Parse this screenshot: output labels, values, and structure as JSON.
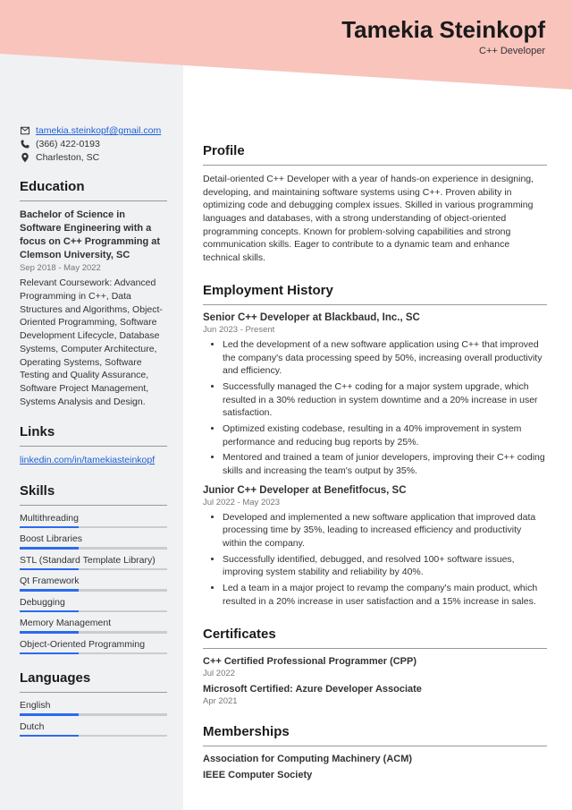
{
  "header": {
    "name": "Tamekia Steinkopf",
    "title": "C++ Developer"
  },
  "contact": {
    "email": "tamekia.steinkopf@gmail.com",
    "phone": "(366) 422-0193",
    "location": "Charleston, SC"
  },
  "education": {
    "heading": "Education",
    "degree": "Bachelor of Science in Software Engineering with a focus on C++ Programming at Clemson University, SC",
    "dates": "Sep 2018 - May 2022",
    "desc": "Relevant Coursework: Advanced Programming in C++, Data Structures and Algorithms, Object-Oriented Programming, Software Development Lifecycle, Database Systems, Computer Architecture, Operating Systems, Software Testing and Quality Assurance, Software Project Management, Systems Analysis and Design."
  },
  "links": {
    "heading": "Links",
    "url": "linkedin.com/in/tamekiasteinkopf"
  },
  "skills": {
    "heading": "Skills",
    "items": [
      {
        "name": "Multithreading",
        "level": 40
      },
      {
        "name": "Boost Libraries",
        "level": 40
      },
      {
        "name": "STL (Standard Template Library)",
        "level": 40
      },
      {
        "name": "Qt Framework",
        "level": 40
      },
      {
        "name": "Debugging",
        "level": 40
      },
      {
        "name": "Memory Management",
        "level": 40
      },
      {
        "name": "Object-Oriented Programming",
        "level": 40
      }
    ]
  },
  "languages": {
    "heading": "Languages",
    "items": [
      {
        "name": "English",
        "level": 40
      },
      {
        "name": "Dutch",
        "level": 40
      }
    ]
  },
  "profile": {
    "heading": "Profile",
    "text": "Detail-oriented C++ Developer with a year of hands-on experience in designing, developing, and maintaining software systems using C++. Proven ability in optimizing code and debugging complex issues. Skilled in various programming languages and databases, with a strong understanding of object-oriented programming concepts. Known for problem-solving capabilities and strong communication skills. Eager to contribute to a dynamic team and enhance technical skills."
  },
  "employment": {
    "heading": "Employment History",
    "jobs": [
      {
        "title": "Senior C++ Developer at Blackbaud, Inc., SC",
        "dates": "Jun 2023 - Present",
        "bullets": [
          "Led the development of a new software application using C++ that improved the company's data processing speed by 50%, increasing overall productivity and efficiency.",
          "Successfully managed the C++ coding for a major system upgrade, which resulted in a 30% reduction in system downtime and a 20% increase in user satisfaction.",
          "Optimized existing codebase, resulting in a 40% improvement in system performance and reducing bug reports by 25%.",
          "Mentored and trained a team of junior developers, improving their C++ coding skills and increasing the team's output by 35%."
        ]
      },
      {
        "title": "Junior C++ Developer at Benefitfocus, SC",
        "dates": "Jul 2022 - May 2023",
        "bullets": [
          "Developed and implemented a new software application that improved data processing time by 35%, leading to increased efficiency and productivity within the company.",
          "Successfully identified, debugged, and resolved 100+ software issues, improving system stability and reliability by 40%.",
          "Led a team in a major project to revamp the company's main product, which resulted in a 20% increase in user satisfaction and a 15% increase in sales."
        ]
      }
    ]
  },
  "certificates": {
    "heading": "Certificates",
    "items": [
      {
        "title": "C++ Certified Professional Programmer (CPP)",
        "date": "Jul 2022"
      },
      {
        "title": "Microsoft Certified: Azure Developer Associate",
        "date": "Apr 2021"
      }
    ]
  },
  "memberships": {
    "heading": "Memberships",
    "items": [
      "Association for Computing Machinery (ACM)",
      "IEEE Computer Society"
    ]
  }
}
